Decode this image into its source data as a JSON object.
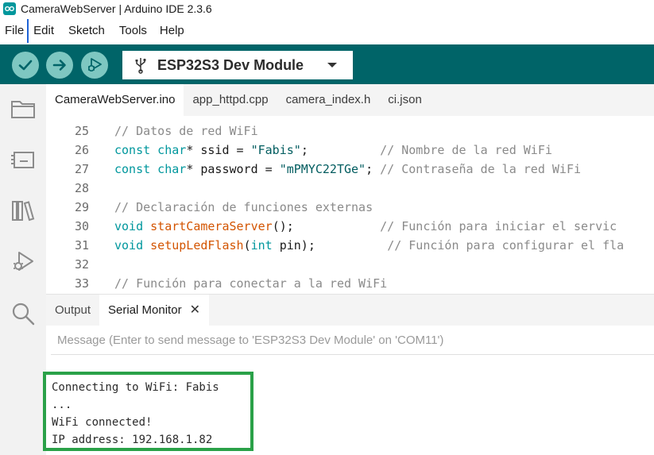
{
  "window": {
    "title": "CameraWebServer | Arduino IDE 2.3.6"
  },
  "menu": {
    "items": [
      "File",
      "Edit",
      "Sketch",
      "Tools",
      "Help"
    ]
  },
  "toolbar": {
    "verify_icon": "checkmark-icon",
    "upload_icon": "arrow-right-icon",
    "debug_icon": "debug-icon",
    "board_name": "ESP32S3 Dev Module",
    "accent": "#006468",
    "button_color": "#7ec7c1"
  },
  "sidebar": {
    "icons": [
      "folder-icon",
      "board-manager-icon",
      "library-icon",
      "debug-icon",
      "search-icon"
    ]
  },
  "tabs": [
    "CameraWebServer.ino",
    "app_httpd.cpp",
    "camera_index.h",
    "ci.json"
  ],
  "editor": {
    "lines": [
      {
        "num": "25",
        "segments": [
          {
            "t": "// Datos de red WiFi",
            "c": "comment"
          }
        ]
      },
      {
        "num": "26",
        "segments": [
          {
            "t": "const char",
            "c": "type"
          },
          {
            "t": "* ssid = ",
            "c": "plain"
          },
          {
            "t": "\"Fabis\"",
            "c": "str"
          },
          {
            "t": ";          ",
            "c": "plain"
          },
          {
            "t": "// Nombre de la red WiFi",
            "c": "comment"
          }
        ]
      },
      {
        "num": "27",
        "segments": [
          {
            "t": "const char",
            "c": "type"
          },
          {
            "t": "* password = ",
            "c": "plain"
          },
          {
            "t": "\"mPMYC22TGe\"",
            "c": "str"
          },
          {
            "t": "; ",
            "c": "plain"
          },
          {
            "t": "// Contraseña de la red WiFi",
            "c": "comment"
          }
        ]
      },
      {
        "num": "28",
        "segments": []
      },
      {
        "num": "29",
        "segments": [
          {
            "t": "// Declaración de funciones externas",
            "c": "comment"
          }
        ]
      },
      {
        "num": "30",
        "segments": [
          {
            "t": "void ",
            "c": "type"
          },
          {
            "t": "startCameraServer",
            "c": "func"
          },
          {
            "t": "();            ",
            "c": "plain"
          },
          {
            "t": "// Función para iniciar el servic",
            "c": "comment"
          }
        ]
      },
      {
        "num": "31",
        "segments": [
          {
            "t": "void ",
            "c": "type"
          },
          {
            "t": "setupLedFlash",
            "c": "func"
          },
          {
            "t": "(",
            "c": "plain"
          },
          {
            "t": "int",
            "c": "type"
          },
          {
            "t": " pin);          ",
            "c": "plain"
          },
          {
            "t": "// Función para configurar el fla",
            "c": "comment"
          }
        ]
      },
      {
        "num": "32",
        "segments": []
      },
      {
        "num": "33",
        "segments": [
          {
            "t": "// Función para conectar a la red WiFi",
            "c": "comment"
          }
        ]
      }
    ]
  },
  "panel": {
    "tabs": [
      "Output",
      "Serial Monitor"
    ],
    "active_tab": "Serial Monitor",
    "message_placeholder": "Message (Enter to send message to 'ESP32S3 Dev Module' on 'COM11')",
    "serial_lines": [
      "Connecting to WiFi: Fabis",
      "...",
      "WiFi connected!",
      "IP address: 192.168.1.82"
    ],
    "highlight_color": "#2aa148"
  }
}
